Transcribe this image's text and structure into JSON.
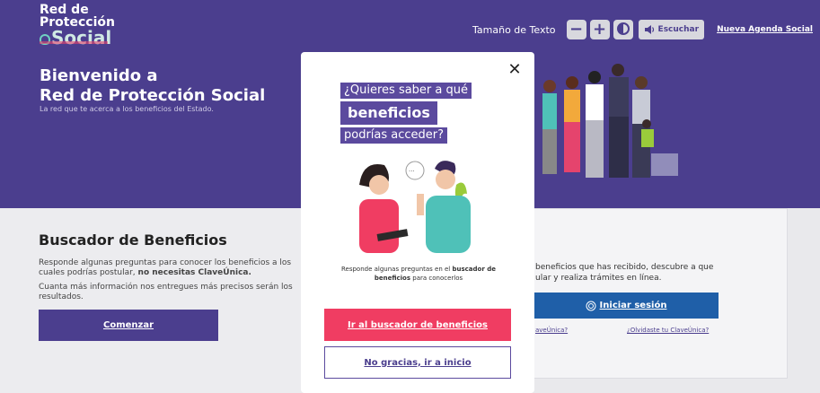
{
  "header": {
    "logo_line1": "Red de",
    "logo_line2": "Protección",
    "logo_line3": "Social",
    "text_size_label": "Tamaño de Texto",
    "decrease_label": "−",
    "increase_label": "+",
    "listen_label": "Escuchar",
    "agenda_link": "Nueva Agenda Social"
  },
  "hero": {
    "title_line1": "Bienvenido a",
    "title_line2": "Red de Protección Social",
    "subtitle": "La red que te acerca a los beneficios del Estado."
  },
  "buscador": {
    "title": "Buscador de Beneficios",
    "p1_text": "Responde algunas preguntas para conocer los beneficios a los cuales podrías postular,",
    "p1_bold": "no necesitas ClaveÚnica.",
    "p2": "Cuanta más información nos entregues más precisos serán los resultados.",
    "button": "Comenzar"
  },
  "right_card": {
    "text_line1": "beneficios que has recibido, descubre a que",
    "text_line2": "ular y realiza trámites en línea.",
    "login_button": "Iniciar sesión",
    "clave_left": "aveÚnica?",
    "clave_right": "¿Olvidaste tu ClaveÚnica?"
  },
  "modal": {
    "close_label": "✕",
    "question_line1": "¿Quieres saber a qué",
    "question_line2": "beneficios",
    "question_line3": "podrías acceder?",
    "speech": "···",
    "desc_pre": "Responde algunas preguntas en el",
    "desc_bold": "buscador de beneficios",
    "desc_post": "para conocerlos",
    "primary_button": "Ir al buscador de beneficios",
    "secondary_button": "No gracias, ir a inicio"
  },
  "colors": {
    "brand_purple": "#4b3e8e",
    "cta_pink": "#f03d62",
    "login_blue": "#1f5fa8"
  }
}
